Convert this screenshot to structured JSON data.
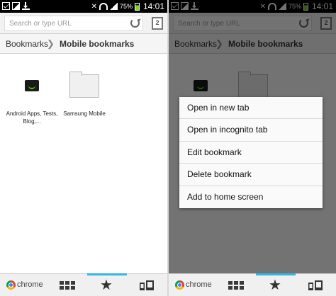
{
  "status_bar": {
    "battery": "75%",
    "time": "14:01"
  },
  "omnibox": {
    "placeholder": "Search or type URL",
    "tab_count": "2"
  },
  "breadcrumb": {
    "root": "Bookmarks",
    "separator": "❯",
    "current": "Mobile bookmarks"
  },
  "bookmarks": [
    {
      "label": "Android Apps, Tests, Blog,...",
      "icon": "android-site-favicon"
    },
    {
      "label": "Samsung Mobile",
      "icon": "folder-icon"
    }
  ],
  "bottom_bar": {
    "chrome_label": "chrome",
    "star_glyph": "★",
    "accent_color": "#33b5e5"
  },
  "context_menu": {
    "items": [
      "Open in new tab",
      "Open in incognito tab",
      "Edit bookmark",
      "Delete bookmark",
      "Add to home screen"
    ]
  }
}
